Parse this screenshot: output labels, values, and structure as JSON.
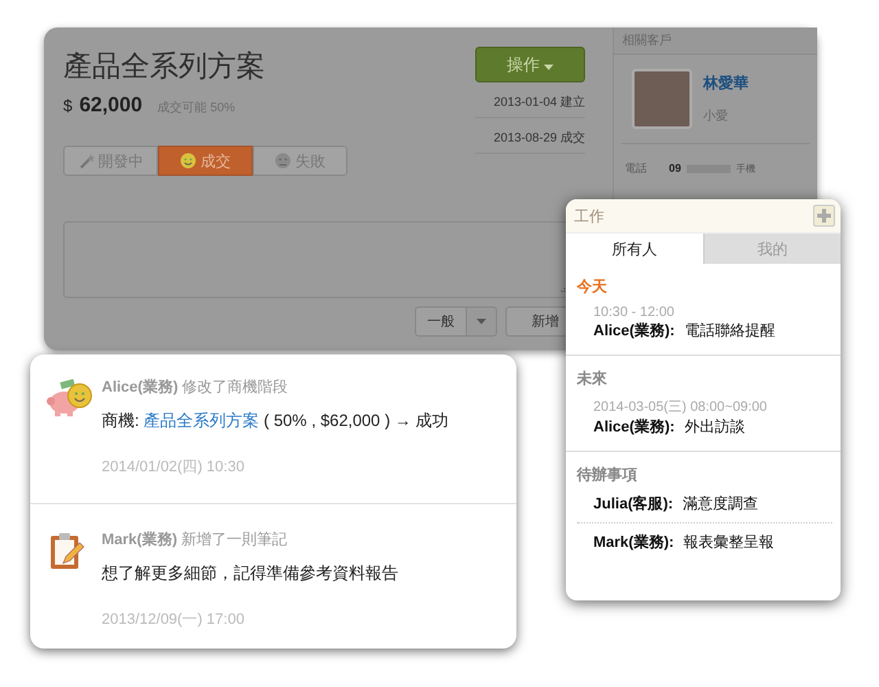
{
  "deal": {
    "title": "產品全系列方案",
    "currency": "$",
    "amount": "62,000",
    "probability": "成交可能 50%",
    "action_button": "操作",
    "stages": [
      {
        "label": "開發中",
        "kind": "wand",
        "selected": false
      },
      {
        "label": "成交",
        "kind": "smile",
        "selected": true
      },
      {
        "label": "失敗",
        "kind": "sad",
        "selected": false
      }
    ],
    "dates": [
      {
        "date": "2013-01-04",
        "label": "建立"
      },
      {
        "date": "2013-08-29",
        "label": "成交"
      }
    ],
    "type_select": "一般",
    "add_button": "新增"
  },
  "related": {
    "heading": "相關客戶",
    "name": "林愛華",
    "nickname": "小愛",
    "phone_label": "電話",
    "phone": "09",
    "phone_type": "手機"
  },
  "feed": [
    {
      "kind": "stage",
      "actor": "Alice(業務)",
      "action": "修改了商機階段",
      "prefix": "商機: ",
      "link": "產品全系列方案",
      "suffix": " ( 50% , $62,000 ) →  成功",
      "time": "2014/01/02(四) 10:30"
    },
    {
      "kind": "note",
      "actor": "Mark(業務)",
      "action": "新增了一則筆記",
      "prefix": "想了解更多細節，記得準備參考資料報告",
      "time": "2013/12/09(一) 17:00"
    }
  ],
  "work": {
    "title": "工作",
    "tabs": [
      {
        "label": "所有人",
        "selected": true
      },
      {
        "label": "我的",
        "selected": false
      }
    ],
    "sections": [
      {
        "heading": "今天",
        "kind": "today",
        "items": [
          {
            "time": "10:30 - 12:00",
            "person": "Alice(業務):",
            "task": "電話聯絡提醒"
          }
        ]
      },
      {
        "heading": "未來",
        "kind": "later",
        "items": [
          {
            "time": "2014-03-05(三) 08:00~09:00",
            "person": "Alice(業務):",
            "task": "外出訪談"
          }
        ]
      },
      {
        "heading": "待辦事項",
        "kind": "todo",
        "items": [
          {
            "person": "Julia(客服):",
            "task": "滿意度調查"
          },
          {
            "person": "Mark(業務):",
            "task": "報表彙整呈報"
          }
        ]
      }
    ]
  }
}
